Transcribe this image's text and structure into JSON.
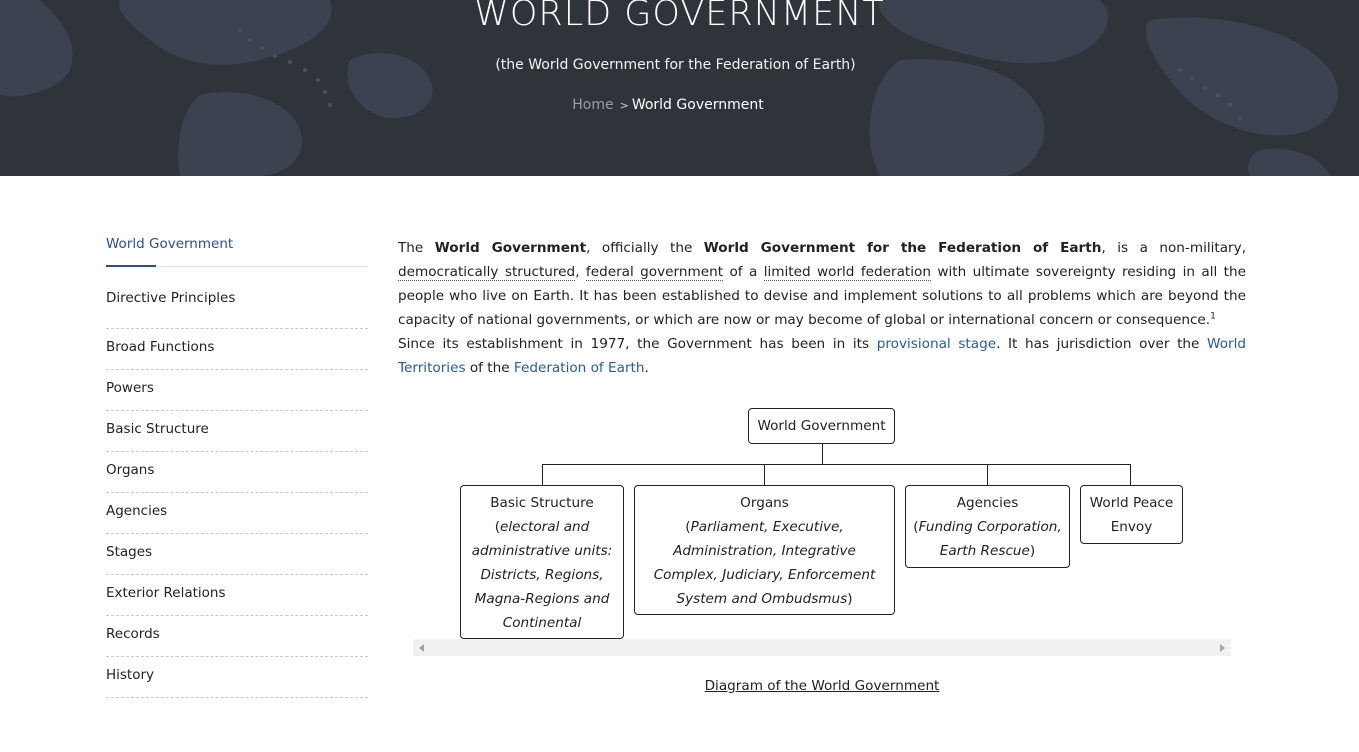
{
  "hero": {
    "title": "WORLD GOVERNMENT",
    "subtitle": "(the World Government for the Federation of Earth)",
    "breadcrumb": {
      "home": "Home",
      "separator": ">",
      "current": "World Government"
    },
    "background_color": "#2f333a"
  },
  "sidebar": {
    "active": "World Government",
    "items": [
      {
        "label": "Directive Principles"
      },
      {
        "label": "Broad Functions"
      },
      {
        "label": "Powers"
      },
      {
        "label": "Basic Structure"
      },
      {
        "label": "Organs"
      },
      {
        "label": "Agencies"
      },
      {
        "label": "Stages"
      },
      {
        "label": "Exterior Relations"
      },
      {
        "label": "Records"
      },
      {
        "label": "History"
      }
    ],
    "accent_color": "#2a4f8f"
  },
  "intro": {
    "t1": "The ",
    "b1": "World Government",
    "t2": ", officially the ",
    "b2": "World Government for the Federation of Earth",
    "t3": ", is a non-military, ",
    "l1": "democratically structured",
    "t4": ", ",
    "l2": "federal government",
    "t5": " of a ",
    "l3": "limited world federation",
    "t6": " with ultimate sovereignty residing in all the people who live on Earth. It has been established to devise and implement solutions to all problems which are beyond the capacity of national governments, or which are now or may become of global or international concern or consequence.",
    "footnote": "1"
  },
  "second": {
    "t1": "Since its establishment in 1977, the Government has been in its ",
    "l1": "provisional stage",
    "t2": ". It has jurisdiction over the ",
    "l2": "World Territories",
    "t3": " of the ",
    "l3": "Federation of Earth",
    "t4": "."
  },
  "diagram": {
    "root": "World Government",
    "children": [
      {
        "title": "Basic Structure",
        "open": "(",
        "detail": "electoral and administrative units: Districts, Regions, Magna-Regions and Continental Divisions",
        "close": ")"
      },
      {
        "title": "Organs",
        "open": "(",
        "detail": "Parliament, Executive, Administration, Integrative Complex, Judiciary, Enforcement System and Ombudsmus",
        "close": ")"
      },
      {
        "title": "Agencies",
        "open": "(",
        "detail": "Funding Corporation, Earth Rescue",
        "close": ")"
      },
      {
        "title": "World Peace Envoy"
      }
    ],
    "caption": "Diagram of the World Government"
  },
  "link_color": "#2a5a98"
}
